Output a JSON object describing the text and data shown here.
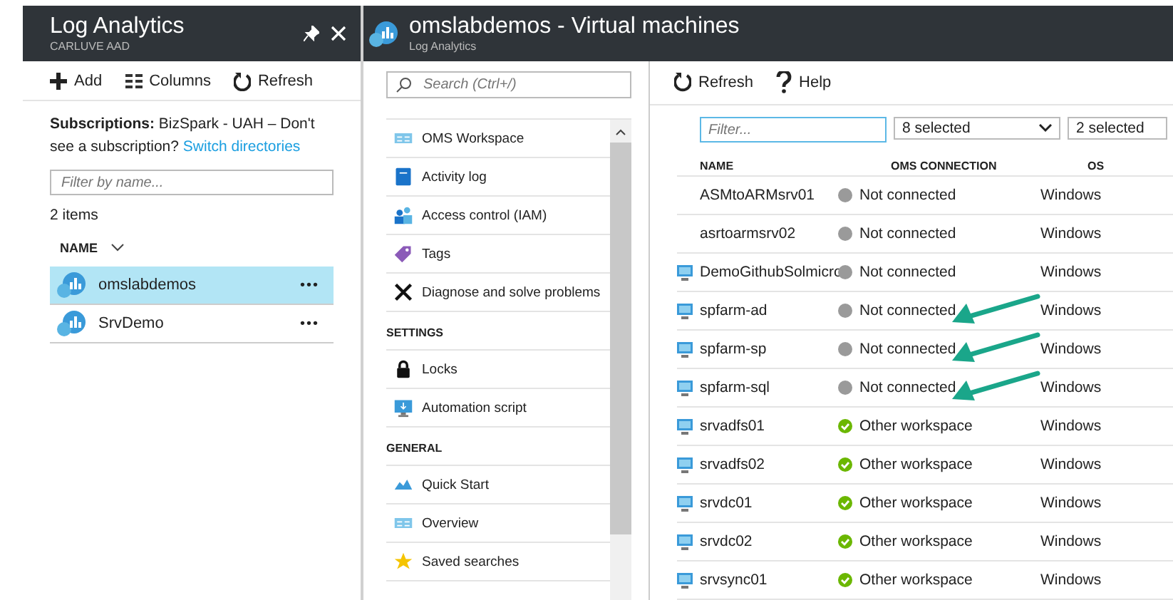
{
  "left_blade": {
    "title": "Log Analytics",
    "subtitle": "CARLUVE AAD",
    "toolbar": [
      {
        "label": "Add"
      },
      {
        "label": "Columns"
      },
      {
        "label": "Refresh"
      }
    ],
    "subscriptions": "**Subscriptions:** BizSpark - UAH – Don't see a subscription?",
    "switch_link": "Switch directories",
    "filter": {
      "placeholder": "Filter by name..."
    },
    "count": "2 items",
    "column": "NAME",
    "items": [
      {
        "name": "omslabdemos",
        "selected": true,
        "more": "•••"
      },
      {
        "name": "SrvDemo",
        "selected": false,
        "more": "•••"
      }
    ]
  },
  "main_blade": {
    "title": "omslabdemos - Virtual machines",
    "subtitle": "Log Analytics",
    "search": {
      "placeholder": "Search (Ctrl+/)"
    },
    "menu": [
      {
        "kind": "item",
        "label": "OMS Workspace"
      },
      {
        "kind": "item",
        "label": "Activity log"
      },
      {
        "kind": "item",
        "label": "Access control (IAM)"
      },
      {
        "kind": "item",
        "label": "Tags"
      },
      {
        "kind": "item",
        "label": "Diagnose and solve problems"
      },
      {
        "kind": "section",
        "label": "SETTINGS"
      },
      {
        "kind": "item",
        "label": "Locks"
      },
      {
        "kind": "item",
        "label": "Automation script"
      },
      {
        "kind": "section",
        "label": "GENERAL"
      },
      {
        "kind": "item",
        "label": "Quick Start"
      },
      {
        "kind": "item",
        "label": "Overview"
      },
      {
        "kind": "item",
        "label": "Saved searches"
      }
    ],
    "toolbar": [
      {
        "label": "Refresh"
      },
      {
        "label": "Help"
      }
    ],
    "filter": {
      "placeholder": "Filter..."
    },
    "dropdowns": [
      "8 selected",
      "2 selected"
    ],
    "table": {
      "columns": [
        "NAME",
        "OMS CONNECTION",
        "OS"
      ],
      "rows": [
        {
          "vm_icon": false,
          "name": "ASMtoARMsrv01",
          "connected": false,
          "connection": "Not connected",
          "os": "Windows",
          "flagged": false
        },
        {
          "vm_icon": false,
          "name": "asrtoarmsrv02",
          "connected": false,
          "connection": "Not connected",
          "os": "Windows",
          "flagged": false
        },
        {
          "vm_icon": true,
          "name": "DemoGithubSolmicro",
          "connected": false,
          "connection": "Not connected",
          "os": "Windows",
          "flagged": false
        },
        {
          "vm_icon": true,
          "name": "spfarm-ad",
          "connected": false,
          "connection": "Not connected",
          "os": "Windows",
          "flagged": true
        },
        {
          "vm_icon": true,
          "name": "spfarm-sp",
          "connected": false,
          "connection": "Not connected",
          "os": "Windows",
          "flagged": true
        },
        {
          "vm_icon": true,
          "name": "spfarm-sql",
          "connected": false,
          "connection": "Not connected",
          "os": "Windows",
          "flagged": true
        },
        {
          "vm_icon": true,
          "name": "srvadfs01",
          "connected": true,
          "connection": "Other workspace",
          "os": "Windows",
          "flagged": false
        },
        {
          "vm_icon": true,
          "name": "srvadfs02",
          "connected": true,
          "connection": "Other workspace",
          "os": "Windows",
          "flagged": false
        },
        {
          "vm_icon": true,
          "name": "srvdc01",
          "connected": true,
          "connection": "Other workspace",
          "os": "Windows",
          "flagged": false
        },
        {
          "vm_icon": true,
          "name": "srvdc02",
          "connected": true,
          "connection": "Other workspace",
          "os": "Windows",
          "flagged": false
        },
        {
          "vm_icon": true,
          "name": "srvsync01",
          "connected": true,
          "connection": "Other workspace",
          "os": "Windows",
          "flagged": false
        }
      ]
    }
  }
}
